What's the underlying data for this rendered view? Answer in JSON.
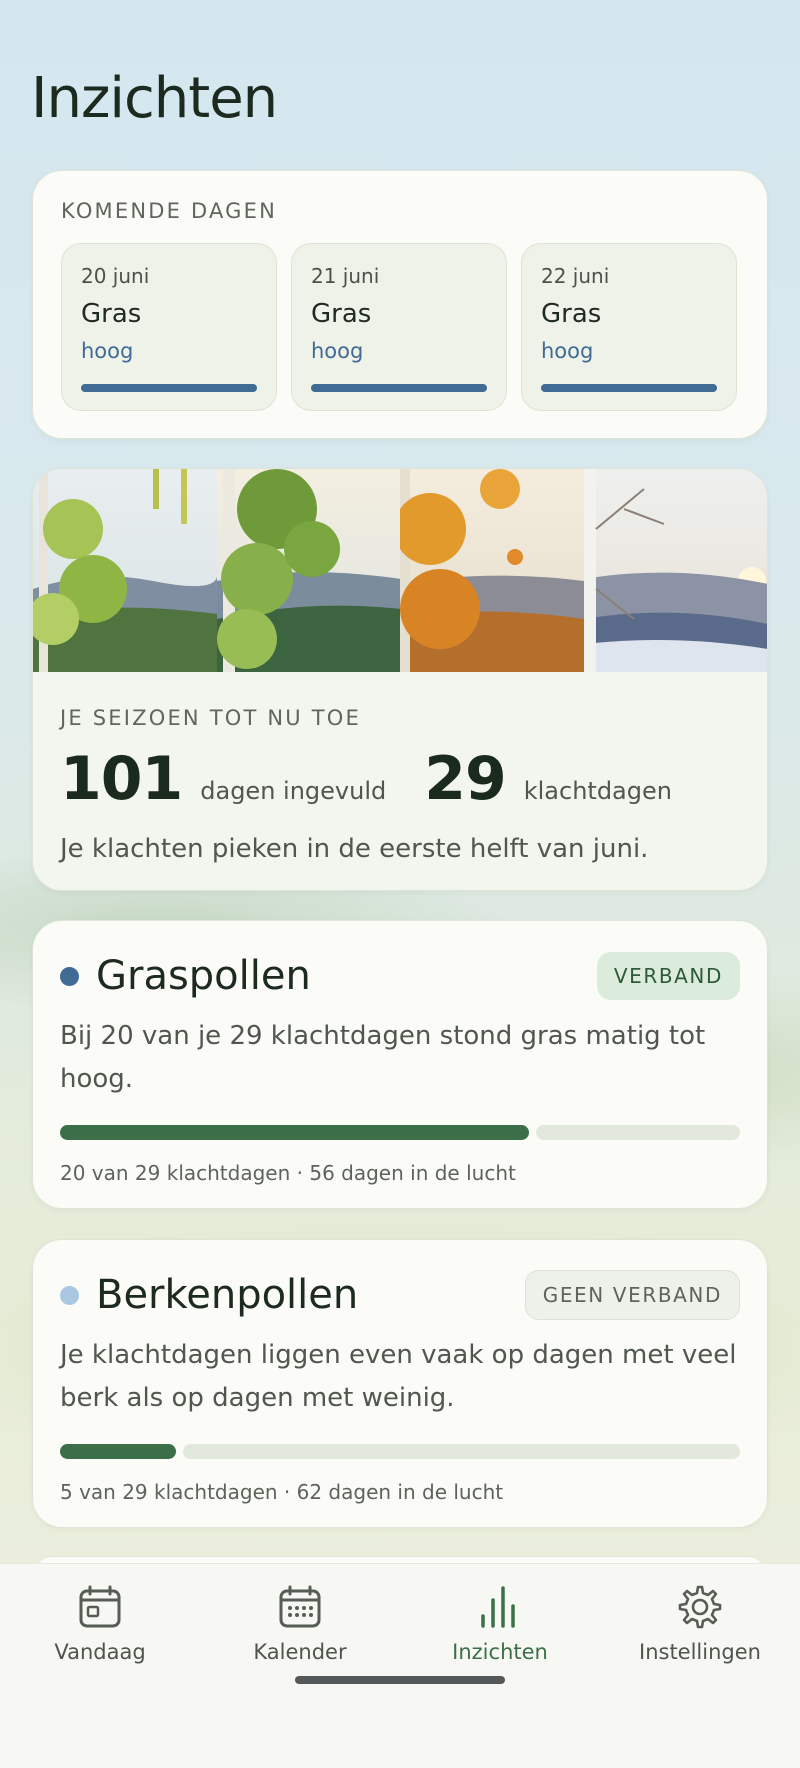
{
  "page": {
    "title": "Inzichten"
  },
  "upcoming": {
    "heading": "KOMENDE DAGEN",
    "days": [
      {
        "date": "20 juni",
        "plant": "Gras",
        "level": "hoog"
      },
      {
        "date": "21 juni",
        "plant": "Gras",
        "level": "hoog"
      },
      {
        "date": "22 juni",
        "plant": "Gras",
        "level": "hoog"
      }
    ]
  },
  "season": {
    "heading": "JE SEIZOEN TOT NU TOE",
    "days_filled": "101",
    "days_filled_label": "dagen ingevuld",
    "complaint_days": "29",
    "complaint_days_label": "klachtdagen",
    "note": "Je klachten pieken in de eerste helft van juni."
  },
  "pollen": [
    {
      "name": "Graspollen",
      "dot_color": "#3f6b95",
      "badge": "VERBAND",
      "text": "Bij 20 van je 29 klachtdagen stond gras matig tot hoog.",
      "fraction": 0.69,
      "footer": "20 van 29 klachtdagen · 56 dagen in de lucht"
    },
    {
      "name": "Berkenpollen",
      "dot_color": "#a9c7e0",
      "badge": "GEEN VERBAND",
      "text": "Je klachtdagen liggen even vaak op dagen met veel berk als op dagen met weinig.",
      "fraction": 0.17,
      "footer": "5 van 29 klachtdagen · 62 dagen in de lucht"
    }
  ],
  "nav": {
    "items": [
      {
        "label": "Vandaag",
        "icon": "calendar-day-icon"
      },
      {
        "label": "Kalender",
        "icon": "calendar-grid-icon"
      },
      {
        "label": "Inzichten",
        "icon": "bar-chart-icon",
        "active": true
      },
      {
        "label": "Instellingen",
        "icon": "gear-icon"
      }
    ]
  },
  "colors": {
    "accent_green": "#3c6e48",
    "accent_blue": "#3f6b95"
  }
}
